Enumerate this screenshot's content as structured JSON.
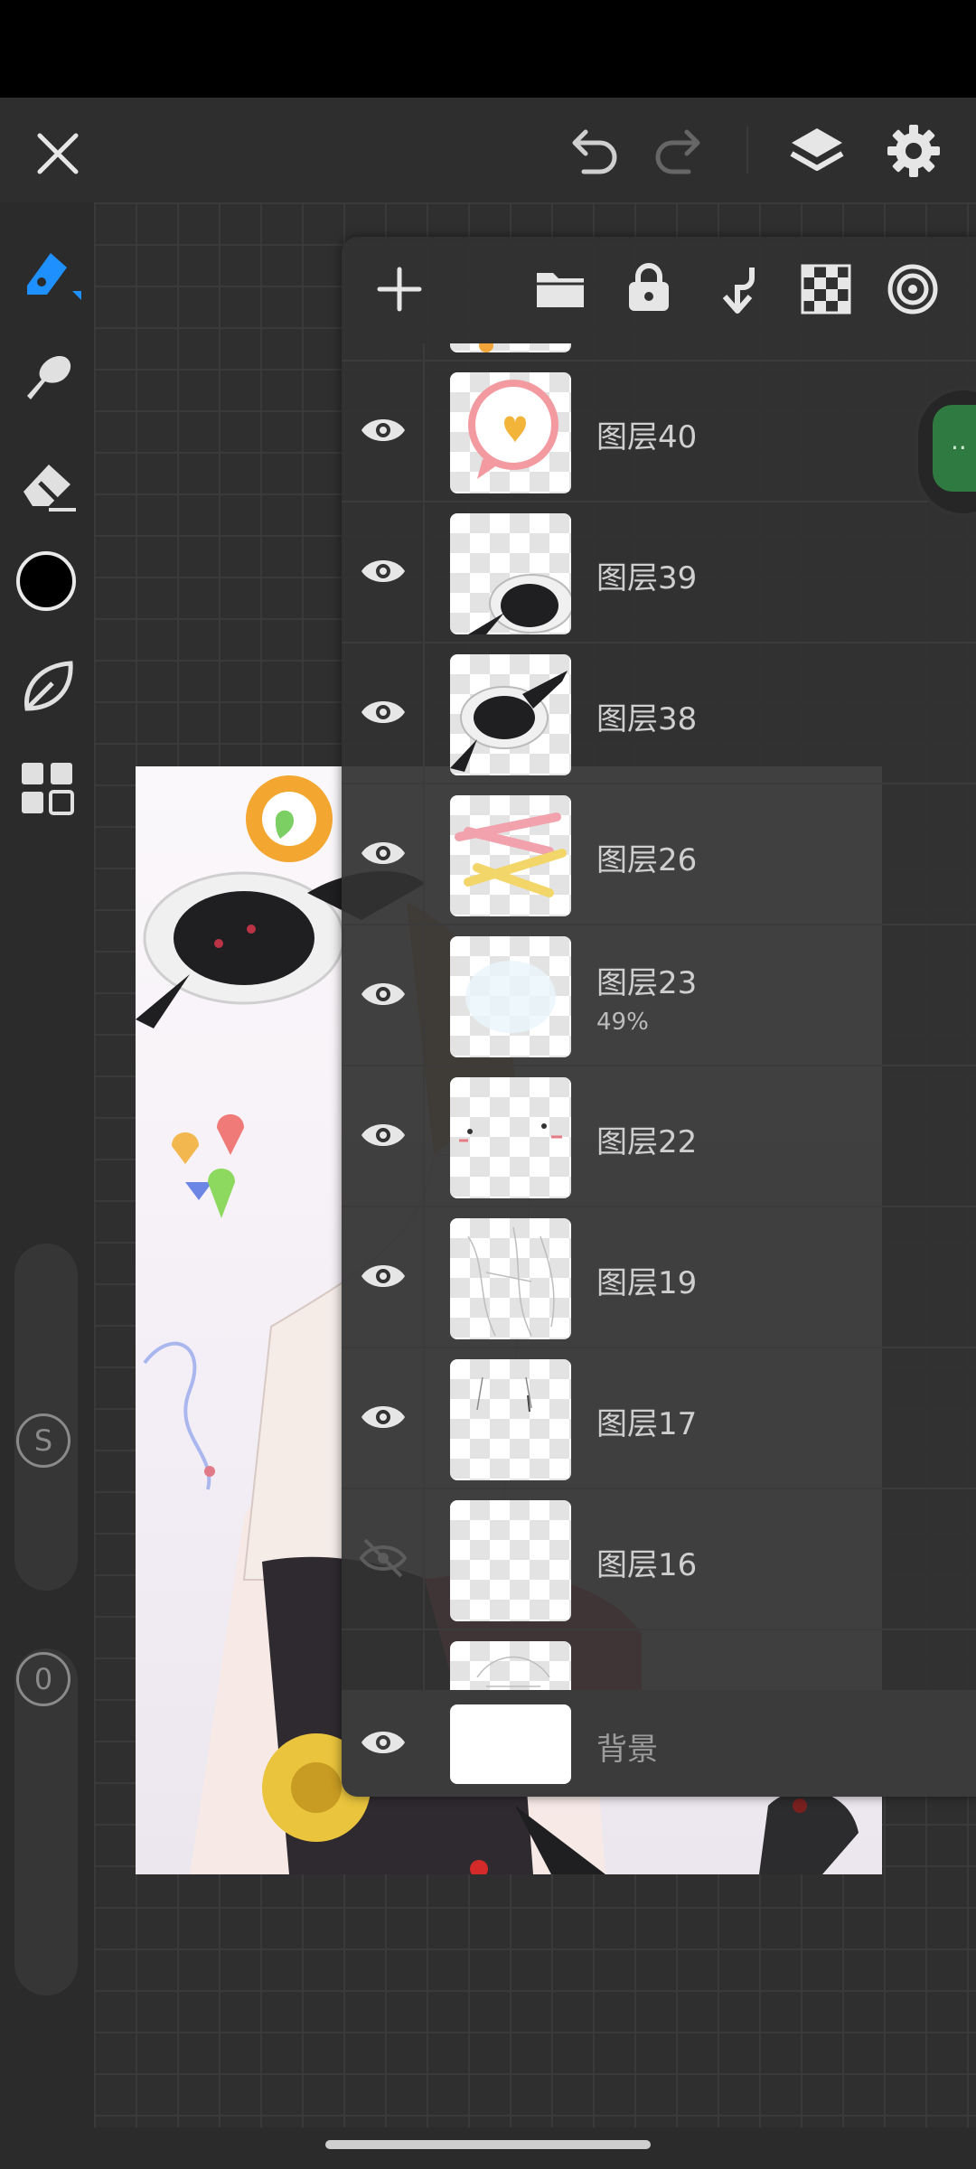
{
  "app": {
    "brush_size_badge": "S",
    "opacity_badge": "0",
    "accent_color": "#1e90ff",
    "current_color": "#000000"
  },
  "topbar": {
    "icons": [
      "close-icon",
      "undo-icon",
      "redo-icon",
      "layers-icon",
      "settings-icon"
    ]
  },
  "left_toolbar": {
    "icons": [
      "brush-icon",
      "smudge-icon",
      "eraser-icon",
      "color-swatch",
      "shape-icon",
      "gallery-icon"
    ]
  },
  "layers_panel": {
    "toolbar_icons": [
      "add-layer-icon",
      "folder-icon",
      "lock-icon",
      "merge-down-icon",
      "transparency-icon",
      "blend-icon"
    ],
    "layers": [
      {
        "name": "图层40",
        "visible": true,
        "opacity": ""
      },
      {
        "name": "图层39",
        "visible": true,
        "opacity": ""
      },
      {
        "name": "图层38",
        "visible": true,
        "opacity": ""
      },
      {
        "name": "图层26",
        "visible": true,
        "opacity": ""
      },
      {
        "name": "图层23",
        "visible": true,
        "opacity": "49%"
      },
      {
        "name": "图层22",
        "visible": true,
        "opacity": ""
      },
      {
        "name": "图层19",
        "visible": true,
        "opacity": ""
      },
      {
        "name": "图层17",
        "visible": true,
        "opacity": ""
      },
      {
        "name": "图层16",
        "visible": false,
        "opacity": ""
      }
    ],
    "background_layer": {
      "name": "背景",
      "visible": true
    }
  }
}
